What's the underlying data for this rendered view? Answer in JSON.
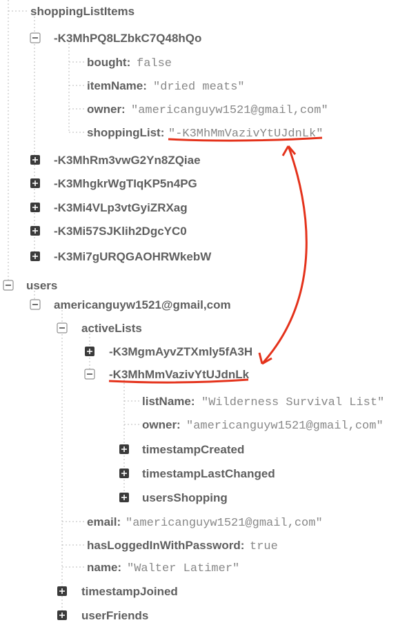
{
  "ic": {
    "plus": "+",
    "minus": "-"
  },
  "tree": {
    "shoppingListItems": {
      "label": "shoppingListItems",
      "child1": {
        "id": "-K3MhPQ8LZbkC7Q48hQo",
        "bought_k": "bought:",
        "bought_v": "false",
        "itemName_k": "itemName:",
        "itemName_v": "\"dried meats\"",
        "owner_k": "owner:",
        "owner_v": "\"americanguyw1521@gmail,com\"",
        "shoppingList_k": "shoppingList:",
        "shoppingList_v": "\"-K3MhMmVazivYtUJdnLk\""
      },
      "c2": "-K3MhRm3vwG2Yn8ZQiae",
      "c3": "-K3MhgkrWgTIqKP5n4PG",
      "c4": "-K3Mi4VLp3vtGyiZRXag",
      "c5": "-K3Mi57SJKlih2DgcYC0",
      "c6": "-K3Mi7gURQGAOHRWkebW"
    },
    "users": {
      "label": "users",
      "u1": {
        "id": "americanguyw1521@gmail,com",
        "activeLists": {
          "label": "activeLists",
          "a1": "-K3MgmAyvZTXmly5fA3H",
          "a2": {
            "id": "-K3MhMmVazivYtUJdnLk",
            "listName_k": "listName:",
            "listName_v": "\"Wilderness Survival List\"",
            "owner_k": "owner:",
            "owner_v": "\"americanguyw1521@gmail,com\"",
            "tsc": "timestampCreated",
            "tslc": "timestampLastChanged",
            "us": "usersShopping"
          }
        },
        "email_k": "email:",
        "email_v": "\"americanguyw1521@gmail,com\"",
        "hliwp_k": "hasLoggedInWithPassword:",
        "hliwp_v": "true",
        "name_k": "name:",
        "name_v": "\"Walter Latimer\"",
        "tj": "timestampJoined",
        "uf": "userFriends"
      }
    }
  }
}
